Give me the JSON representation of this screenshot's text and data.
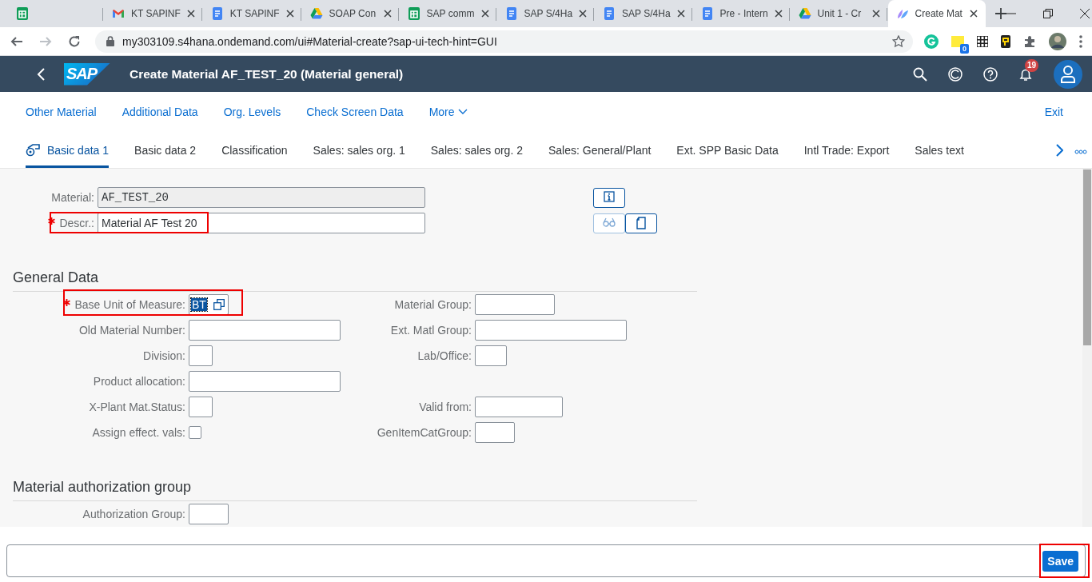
{
  "browser": {
    "tabs": [
      {
        "kind": "sheets",
        "selected": false
      },
      {
        "kind": "gmail",
        "title": "KT SAPINF",
        "selected": false
      },
      {
        "kind": "docs",
        "title": "KT SAPINF",
        "selected": false
      },
      {
        "kind": "drive",
        "title": "SOAP Con",
        "selected": false
      },
      {
        "kind": "sheets",
        "title": "SAP comm",
        "selected": false
      },
      {
        "kind": "docs",
        "title": "SAP S/4Ha",
        "selected": false
      },
      {
        "kind": "docs",
        "title": "SAP S/4Ha",
        "selected": false
      },
      {
        "kind": "docs",
        "title": "Pre - Intern",
        "selected": false
      },
      {
        "kind": "drive",
        "title": "Unit 1 - Cr",
        "selected": false
      },
      {
        "kind": "fiori",
        "title": "Create Mat",
        "selected": true
      }
    ],
    "address": "my303109.s4hana.ondemand.com/ui#Material-create?sap-ui-tech-hint=GUI",
    "extension_badge": "0"
  },
  "shell": {
    "logo": "SAP",
    "title": "Create Material AF_TEST_20 (Material general)",
    "notification_count": "19"
  },
  "toolbar": {
    "actions": [
      "Other Material",
      "Additional Data",
      "Org. Levels",
      "Check Screen Data"
    ],
    "more": "More",
    "exit": "Exit"
  },
  "tabs": [
    {
      "label": "Basic data 1",
      "selected": true
    },
    {
      "label": "Basic data 2",
      "selected": false
    },
    {
      "label": "Classification",
      "selected": false
    },
    {
      "label": "Sales: sales org. 1",
      "selected": false
    },
    {
      "label": "Sales: sales org. 2",
      "selected": false
    },
    {
      "label": "Sales: General/Plant",
      "selected": false
    },
    {
      "label": "Ext. SPP Basic Data",
      "selected": false
    },
    {
      "label": "Intl Trade: Export",
      "selected": false
    },
    {
      "label": "Sales text",
      "selected": false
    }
  ],
  "header_fields": [
    {
      "label": "Material:",
      "value": "AF_TEST_20",
      "required": false,
      "disabled": true,
      "highlighted": false,
      "buttons": [
        {
          "kind": "info",
          "disabled": false
        }
      ]
    },
    {
      "label": "Descr.:",
      "value": "Material AF Test 20",
      "required": true,
      "disabled": false,
      "highlighted": true,
      "buttons": [
        {
          "kind": "glasses",
          "disabled": true
        },
        {
          "kind": "document",
          "disabled": false
        }
      ]
    }
  ],
  "sections": [
    {
      "title": "General Data",
      "rows": [
        [
          {
            "kind": "valuehelp",
            "label": "Base Unit of Measure:",
            "value": "BT",
            "required": true,
            "focused": true,
            "highlighted": true
          },
          {
            "kind": "text",
            "label": "Material Group:"
          }
        ],
        [
          {
            "kind": "text",
            "label": "Old Material Number:"
          },
          {
            "kind": "text",
            "label": "Ext. Matl Group:"
          }
        ],
        [
          {
            "kind": "text",
            "label": "Division:"
          },
          {
            "kind": "text",
            "label": "Lab/Office:"
          }
        ],
        [
          {
            "kind": "text",
            "label": "Product allocation:"
          }
        ],
        [
          {
            "kind": "text",
            "label": "X-Plant Mat.Status:"
          },
          {
            "kind": "text",
            "label": "Valid from:"
          }
        ],
        [
          {
            "kind": "checkbox",
            "label": "Assign effect. vals:",
            "checked": false
          },
          {
            "kind": "text",
            "label": "GenItemCatGroup:"
          }
        ]
      ]
    },
    {
      "title": "Material authorization group",
      "rows": [
        [
          {
            "kind": "text",
            "label": "Authorization Group:"
          }
        ]
      ]
    }
  ],
  "command_bar": {
    "save": "Save",
    "highlighted": true
  }
}
